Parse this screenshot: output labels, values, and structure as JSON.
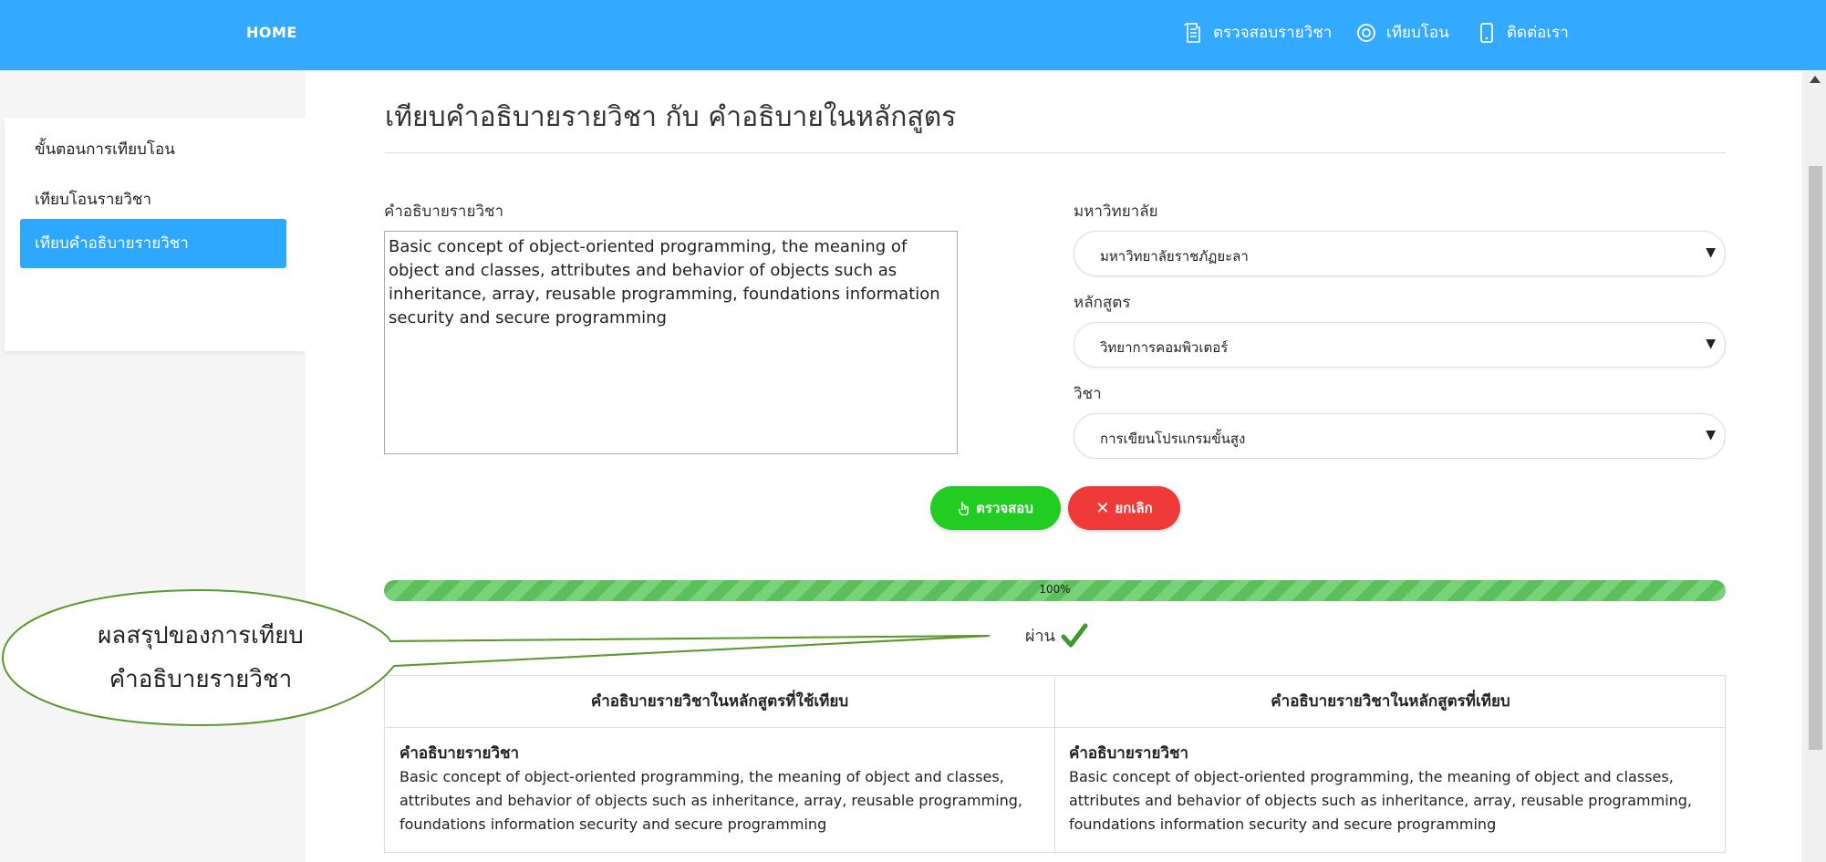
{
  "navbar": {
    "home": "HOME",
    "items": [
      {
        "label": "ตรวจสอบรายวิชา",
        "icon": "document-icon"
      },
      {
        "label": "เทียบโอน",
        "icon": "target-icon"
      },
      {
        "label": "ติดต่อเรา",
        "icon": "phone-icon"
      }
    ]
  },
  "sidebar": {
    "items": [
      {
        "label": "ขั้นตอนการเทียบโอน",
        "active": false
      },
      {
        "label": "เทียบโอนรายวิชา",
        "active": false
      },
      {
        "label": "เทียบคำอธิบายรายวิชา",
        "active": true
      }
    ]
  },
  "main": {
    "title": "เทียบคำอธิบายรายวิชา กับ คำอธิบายในหลักสูตร",
    "description_label": "คำอธิบายรายวิชา",
    "description_value": "Basic concept of object-oriented programming, the meaning of object and classes, attributes and behavior of objects such as inheritance, array, reusable programming, foundations information security and secure programming",
    "university_label": "มหาวิทยาลัย",
    "university_value": "มหาวิทยาลัยราชภัฏยะลา",
    "curriculum_label": "หลักสูตร",
    "curriculum_value": "วิทยาการคอมพิวเตอร์",
    "subject_label": "วิชา",
    "subject_value": "การเขียนโปรแกรมขั้นสูง",
    "check_button": "ตรวจสอบ",
    "cancel_button": "ยกเลิก",
    "progress_value": 1.0,
    "progress_text": "100%",
    "result_text": "ผ่าน",
    "table": {
      "headers": [
        "คำอธิบายรายวิชาในหลักสูตรที่ใช้เทียบ",
        "คำอธิบายรายวิชาในหลักสูตรที่เทียบ"
      ],
      "cells": [
        {
          "label": "คำอธิบายรายวิชา",
          "text": "Basic concept of object-oriented programming, the meaning of object and classes, attributes and behavior of objects such as inheritance, array, reusable programming, foundations information security and secure programming"
        },
        {
          "label": "คำอธิบายรายวิชา",
          "text": "Basic concept of object-oriented programming, the meaning of object and classes, attributes and behavior of objects such as inheritance, array, reusable programming, foundations information security and secure programming"
        }
      ]
    }
  },
  "callout": {
    "line1": "ผลสรุปของการเทียบ",
    "line2": "คำอธิบายรายวิชา"
  },
  "colors": {
    "navbar": "#33aaff",
    "active_sidebar": "#2ea7ff",
    "check_button": "#22cc22",
    "cancel_button": "#f03a3a",
    "progress": "#5bbf5b",
    "callout_border": "#5a9a2a"
  }
}
